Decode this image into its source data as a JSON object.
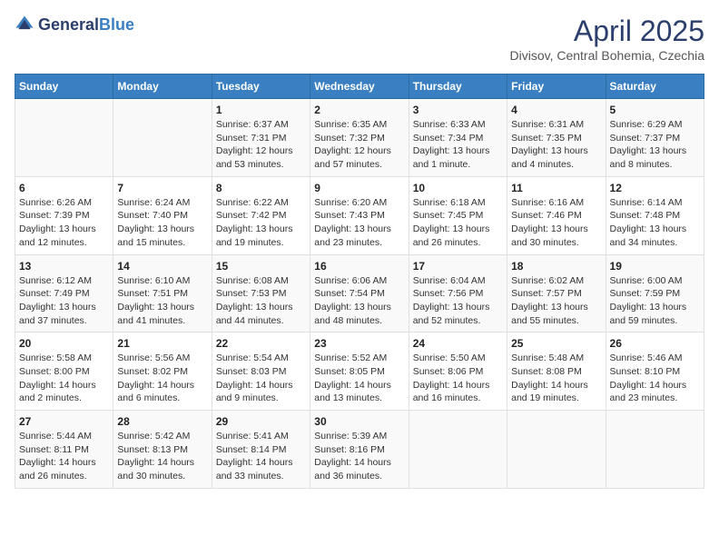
{
  "header": {
    "logo_general": "General",
    "logo_blue": "Blue",
    "title": "April 2025",
    "subtitle": "Divisov, Central Bohemia, Czechia"
  },
  "days_of_week": [
    "Sunday",
    "Monday",
    "Tuesday",
    "Wednesday",
    "Thursday",
    "Friday",
    "Saturday"
  ],
  "weeks": [
    [
      {
        "day": "",
        "detail": ""
      },
      {
        "day": "",
        "detail": ""
      },
      {
        "day": "1",
        "detail": "Sunrise: 6:37 AM\nSunset: 7:31 PM\nDaylight: 12 hours\nand 53 minutes."
      },
      {
        "day": "2",
        "detail": "Sunrise: 6:35 AM\nSunset: 7:32 PM\nDaylight: 12 hours\nand 57 minutes."
      },
      {
        "day": "3",
        "detail": "Sunrise: 6:33 AM\nSunset: 7:34 PM\nDaylight: 13 hours\nand 1 minute."
      },
      {
        "day": "4",
        "detail": "Sunrise: 6:31 AM\nSunset: 7:35 PM\nDaylight: 13 hours\nand 4 minutes."
      },
      {
        "day": "5",
        "detail": "Sunrise: 6:29 AM\nSunset: 7:37 PM\nDaylight: 13 hours\nand 8 minutes."
      }
    ],
    [
      {
        "day": "6",
        "detail": "Sunrise: 6:26 AM\nSunset: 7:39 PM\nDaylight: 13 hours\nand 12 minutes."
      },
      {
        "day": "7",
        "detail": "Sunrise: 6:24 AM\nSunset: 7:40 PM\nDaylight: 13 hours\nand 15 minutes."
      },
      {
        "day": "8",
        "detail": "Sunrise: 6:22 AM\nSunset: 7:42 PM\nDaylight: 13 hours\nand 19 minutes."
      },
      {
        "day": "9",
        "detail": "Sunrise: 6:20 AM\nSunset: 7:43 PM\nDaylight: 13 hours\nand 23 minutes."
      },
      {
        "day": "10",
        "detail": "Sunrise: 6:18 AM\nSunset: 7:45 PM\nDaylight: 13 hours\nand 26 minutes."
      },
      {
        "day": "11",
        "detail": "Sunrise: 6:16 AM\nSunset: 7:46 PM\nDaylight: 13 hours\nand 30 minutes."
      },
      {
        "day": "12",
        "detail": "Sunrise: 6:14 AM\nSunset: 7:48 PM\nDaylight: 13 hours\nand 34 minutes."
      }
    ],
    [
      {
        "day": "13",
        "detail": "Sunrise: 6:12 AM\nSunset: 7:49 PM\nDaylight: 13 hours\nand 37 minutes."
      },
      {
        "day": "14",
        "detail": "Sunrise: 6:10 AM\nSunset: 7:51 PM\nDaylight: 13 hours\nand 41 minutes."
      },
      {
        "day": "15",
        "detail": "Sunrise: 6:08 AM\nSunset: 7:53 PM\nDaylight: 13 hours\nand 44 minutes."
      },
      {
        "day": "16",
        "detail": "Sunrise: 6:06 AM\nSunset: 7:54 PM\nDaylight: 13 hours\nand 48 minutes."
      },
      {
        "day": "17",
        "detail": "Sunrise: 6:04 AM\nSunset: 7:56 PM\nDaylight: 13 hours\nand 52 minutes."
      },
      {
        "day": "18",
        "detail": "Sunrise: 6:02 AM\nSunset: 7:57 PM\nDaylight: 13 hours\nand 55 minutes."
      },
      {
        "day": "19",
        "detail": "Sunrise: 6:00 AM\nSunset: 7:59 PM\nDaylight: 13 hours\nand 59 minutes."
      }
    ],
    [
      {
        "day": "20",
        "detail": "Sunrise: 5:58 AM\nSunset: 8:00 PM\nDaylight: 14 hours\nand 2 minutes."
      },
      {
        "day": "21",
        "detail": "Sunrise: 5:56 AM\nSunset: 8:02 PM\nDaylight: 14 hours\nand 6 minutes."
      },
      {
        "day": "22",
        "detail": "Sunrise: 5:54 AM\nSunset: 8:03 PM\nDaylight: 14 hours\nand 9 minutes."
      },
      {
        "day": "23",
        "detail": "Sunrise: 5:52 AM\nSunset: 8:05 PM\nDaylight: 14 hours\nand 13 minutes."
      },
      {
        "day": "24",
        "detail": "Sunrise: 5:50 AM\nSunset: 8:06 PM\nDaylight: 14 hours\nand 16 minutes."
      },
      {
        "day": "25",
        "detail": "Sunrise: 5:48 AM\nSunset: 8:08 PM\nDaylight: 14 hours\nand 19 minutes."
      },
      {
        "day": "26",
        "detail": "Sunrise: 5:46 AM\nSunset: 8:10 PM\nDaylight: 14 hours\nand 23 minutes."
      }
    ],
    [
      {
        "day": "27",
        "detail": "Sunrise: 5:44 AM\nSunset: 8:11 PM\nDaylight: 14 hours\nand 26 minutes."
      },
      {
        "day": "28",
        "detail": "Sunrise: 5:42 AM\nSunset: 8:13 PM\nDaylight: 14 hours\nand 30 minutes."
      },
      {
        "day": "29",
        "detail": "Sunrise: 5:41 AM\nSunset: 8:14 PM\nDaylight: 14 hours\nand 33 minutes."
      },
      {
        "day": "30",
        "detail": "Sunrise: 5:39 AM\nSunset: 8:16 PM\nDaylight: 14 hours\nand 36 minutes."
      },
      {
        "day": "",
        "detail": ""
      },
      {
        "day": "",
        "detail": ""
      },
      {
        "day": "",
        "detail": ""
      }
    ]
  ]
}
